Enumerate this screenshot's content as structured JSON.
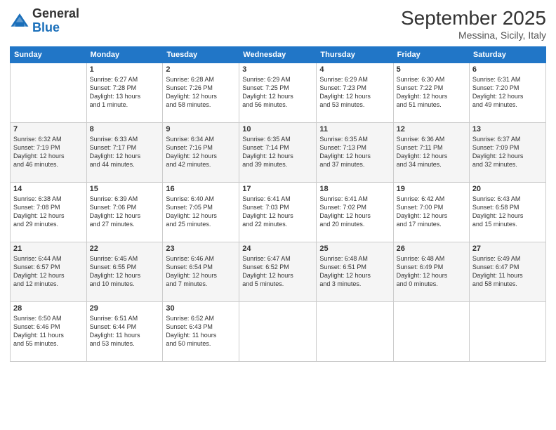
{
  "header": {
    "logo_general": "General",
    "logo_blue": "Blue",
    "month": "September 2025",
    "location": "Messina, Sicily, Italy"
  },
  "columns": [
    "Sunday",
    "Monday",
    "Tuesday",
    "Wednesday",
    "Thursday",
    "Friday",
    "Saturday"
  ],
  "weeks": [
    [
      {
        "day": "",
        "detail": ""
      },
      {
        "day": "1",
        "detail": "Sunrise: 6:27 AM\nSunset: 7:28 PM\nDaylight: 13 hours\nand 1 minute."
      },
      {
        "day": "2",
        "detail": "Sunrise: 6:28 AM\nSunset: 7:26 PM\nDaylight: 12 hours\nand 58 minutes."
      },
      {
        "day": "3",
        "detail": "Sunrise: 6:29 AM\nSunset: 7:25 PM\nDaylight: 12 hours\nand 56 minutes."
      },
      {
        "day": "4",
        "detail": "Sunrise: 6:29 AM\nSunset: 7:23 PM\nDaylight: 12 hours\nand 53 minutes."
      },
      {
        "day": "5",
        "detail": "Sunrise: 6:30 AM\nSunset: 7:22 PM\nDaylight: 12 hours\nand 51 minutes."
      },
      {
        "day": "6",
        "detail": "Sunrise: 6:31 AM\nSunset: 7:20 PM\nDaylight: 12 hours\nand 49 minutes."
      }
    ],
    [
      {
        "day": "7",
        "detail": "Sunrise: 6:32 AM\nSunset: 7:19 PM\nDaylight: 12 hours\nand 46 minutes."
      },
      {
        "day": "8",
        "detail": "Sunrise: 6:33 AM\nSunset: 7:17 PM\nDaylight: 12 hours\nand 44 minutes."
      },
      {
        "day": "9",
        "detail": "Sunrise: 6:34 AM\nSunset: 7:16 PM\nDaylight: 12 hours\nand 42 minutes."
      },
      {
        "day": "10",
        "detail": "Sunrise: 6:35 AM\nSunset: 7:14 PM\nDaylight: 12 hours\nand 39 minutes."
      },
      {
        "day": "11",
        "detail": "Sunrise: 6:35 AM\nSunset: 7:13 PM\nDaylight: 12 hours\nand 37 minutes."
      },
      {
        "day": "12",
        "detail": "Sunrise: 6:36 AM\nSunset: 7:11 PM\nDaylight: 12 hours\nand 34 minutes."
      },
      {
        "day": "13",
        "detail": "Sunrise: 6:37 AM\nSunset: 7:09 PM\nDaylight: 12 hours\nand 32 minutes."
      }
    ],
    [
      {
        "day": "14",
        "detail": "Sunrise: 6:38 AM\nSunset: 7:08 PM\nDaylight: 12 hours\nand 29 minutes."
      },
      {
        "day": "15",
        "detail": "Sunrise: 6:39 AM\nSunset: 7:06 PM\nDaylight: 12 hours\nand 27 minutes."
      },
      {
        "day": "16",
        "detail": "Sunrise: 6:40 AM\nSunset: 7:05 PM\nDaylight: 12 hours\nand 25 minutes."
      },
      {
        "day": "17",
        "detail": "Sunrise: 6:41 AM\nSunset: 7:03 PM\nDaylight: 12 hours\nand 22 minutes."
      },
      {
        "day": "18",
        "detail": "Sunrise: 6:41 AM\nSunset: 7:02 PM\nDaylight: 12 hours\nand 20 minutes."
      },
      {
        "day": "19",
        "detail": "Sunrise: 6:42 AM\nSunset: 7:00 PM\nDaylight: 12 hours\nand 17 minutes."
      },
      {
        "day": "20",
        "detail": "Sunrise: 6:43 AM\nSunset: 6:58 PM\nDaylight: 12 hours\nand 15 minutes."
      }
    ],
    [
      {
        "day": "21",
        "detail": "Sunrise: 6:44 AM\nSunset: 6:57 PM\nDaylight: 12 hours\nand 12 minutes."
      },
      {
        "day": "22",
        "detail": "Sunrise: 6:45 AM\nSunset: 6:55 PM\nDaylight: 12 hours\nand 10 minutes."
      },
      {
        "day": "23",
        "detail": "Sunrise: 6:46 AM\nSunset: 6:54 PM\nDaylight: 12 hours\nand 7 minutes."
      },
      {
        "day": "24",
        "detail": "Sunrise: 6:47 AM\nSunset: 6:52 PM\nDaylight: 12 hours\nand 5 minutes."
      },
      {
        "day": "25",
        "detail": "Sunrise: 6:48 AM\nSunset: 6:51 PM\nDaylight: 12 hours\nand 3 minutes."
      },
      {
        "day": "26",
        "detail": "Sunrise: 6:48 AM\nSunset: 6:49 PM\nDaylight: 12 hours\nand 0 minutes."
      },
      {
        "day": "27",
        "detail": "Sunrise: 6:49 AM\nSunset: 6:47 PM\nDaylight: 11 hours\nand 58 minutes."
      }
    ],
    [
      {
        "day": "28",
        "detail": "Sunrise: 6:50 AM\nSunset: 6:46 PM\nDaylight: 11 hours\nand 55 minutes."
      },
      {
        "day": "29",
        "detail": "Sunrise: 6:51 AM\nSunset: 6:44 PM\nDaylight: 11 hours\nand 53 minutes."
      },
      {
        "day": "30",
        "detail": "Sunrise: 6:52 AM\nSunset: 6:43 PM\nDaylight: 11 hours\nand 50 minutes."
      },
      {
        "day": "",
        "detail": ""
      },
      {
        "day": "",
        "detail": ""
      },
      {
        "day": "",
        "detail": ""
      },
      {
        "day": "",
        "detail": ""
      }
    ]
  ]
}
